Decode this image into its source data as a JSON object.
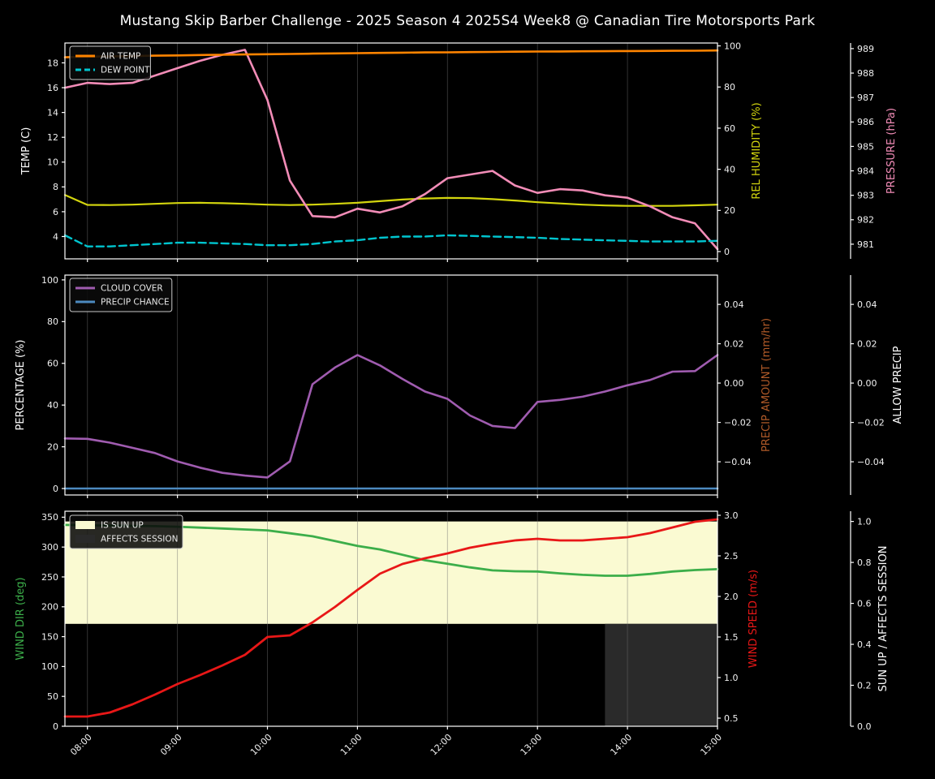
{
  "title": "Mustang Skip Barber Challenge - 2025 Season 4 2025S4 Week8 @ Canadian Tire Motorsports Park",
  "x_axis": {
    "start": "07:45",
    "end": "15:00",
    "tick_labels": [
      "08:00",
      "09:00",
      "10:00",
      "11:00",
      "12:00",
      "13:00",
      "14:00",
      "15:00"
    ]
  },
  "times": [
    "07:45",
    "08:00",
    "08:15",
    "08:30",
    "08:45",
    "09:00",
    "09:15",
    "09:30",
    "09:45",
    "10:00",
    "10:15",
    "10:30",
    "10:45",
    "11:00",
    "11:15",
    "11:30",
    "11:45",
    "12:00",
    "12:15",
    "12:30",
    "12:45",
    "13:00",
    "13:15",
    "13:30",
    "13:45",
    "14:00",
    "14:15",
    "14:30",
    "14:45",
    "15:00"
  ],
  "colors": {
    "background": "#000000",
    "spine": "#ffffff",
    "tick_text": "#f0f0f0",
    "grid": "#6e6e6e",
    "air_temp": "#ff8400",
    "dew_point": "#00c5cf",
    "rel_humidity": "#d3d50e",
    "pressure": "#f28cb7",
    "cloud_cover": "#a05cb0",
    "precip_chance": "#4d8ac0",
    "precip_amount_label": "#b05a28",
    "wind_dir": "#3cae4a",
    "wind_speed": "#e81717",
    "sun_up_band": "#fafad2",
    "affects_session_band": "#2a2a2a"
  },
  "chart_data": [
    {
      "type": "line",
      "name": "temperature-humidity-pressure",
      "left_axis": {
        "label": "TEMP (C)",
        "color": "#ffffff",
        "tick_labels": [
          "4",
          "6",
          "8",
          "10",
          "12",
          "14",
          "16",
          "18"
        ],
        "tick_values": [
          4,
          6,
          8,
          10,
          12,
          14,
          16,
          18
        ],
        "range": [
          2.2,
          19.6
        ]
      },
      "right_axis": {
        "label": "REL HUMIDITY (%)",
        "color": "#d3d50e",
        "tick_labels": [
          "0",
          "20",
          "40",
          "60",
          "80",
          "100"
        ],
        "tick_values": [
          0,
          20,
          40,
          60,
          80,
          100
        ],
        "range": [
          -3.55,
          101.4
        ]
      },
      "far_right_axis": {
        "label": "PRESSURE (hPa)",
        "color": "#f28cb7",
        "tick_labels": [
          "981",
          "982",
          "983",
          "984",
          "985",
          "986",
          "987",
          "988",
          "989"
        ],
        "tick_values": [
          981,
          982,
          983,
          984,
          985,
          986,
          987,
          988,
          989
        ],
        "range": [
          980.4,
          989.23
        ]
      },
      "legend": [
        {
          "label": "AIR TEMP",
          "color": "#ff8400",
          "swatch": "line"
        },
        {
          "label": "DEW POINT",
          "color": "#00c5cf",
          "swatch": "dashed-line"
        }
      ],
      "series": [
        {
          "name": "REL HUMIDITY",
          "axis": "right",
          "color": "#d3d50e",
          "width": 2.2,
          "values": [
            27.5,
            22.7,
            22.6,
            22.8,
            23.2,
            23.6,
            23.7,
            23.5,
            23.2,
            22.8,
            22.6,
            22.8,
            23.2,
            23.7,
            24.5,
            25.3,
            25.8,
            26.1,
            26.0,
            25.5,
            24.8,
            24.0,
            23.4,
            22.8,
            22.4,
            22.2,
            22.2,
            22.2,
            22.5,
            22.8
          ]
        },
        {
          "name": "PRESSURE",
          "axis": "far",
          "color": "#f28cb7",
          "width": 2.6,
          "values": [
            987.4,
            987.6,
            987.55,
            987.6,
            987.9,
            988.2,
            988.5,
            988.75,
            988.95,
            986.9,
            983.6,
            982.15,
            982.1,
            982.45,
            982.3,
            982.55,
            983.05,
            983.7,
            983.85,
            984.0,
            983.4,
            983.1,
            983.25,
            983.2,
            983.0,
            982.9,
            982.55,
            982.1,
            981.85,
            980.8
          ]
        },
        {
          "name": "DEW POINT",
          "axis": "left",
          "color": "#00c5cf",
          "width": 2.4,
          "dash": "9 5",
          "values": [
            4.1,
            3.2,
            3.2,
            3.3,
            3.4,
            3.5,
            3.5,
            3.45,
            3.4,
            3.3,
            3.3,
            3.4,
            3.6,
            3.7,
            3.9,
            4.0,
            4.0,
            4.1,
            4.05,
            4.0,
            3.95,
            3.9,
            3.8,
            3.75,
            3.7,
            3.65,
            3.6,
            3.6,
            3.6,
            3.65
          ]
        },
        {
          "name": "AIR TEMP",
          "axis": "left",
          "color": "#ff8400",
          "width": 2.6,
          "values": [
            18.45,
            18.5,
            18.52,
            18.55,
            18.58,
            18.6,
            18.63,
            18.65,
            18.68,
            18.7,
            18.72,
            18.74,
            18.76,
            18.78,
            18.8,
            18.82,
            18.84,
            18.85,
            18.87,
            18.88,
            18.9,
            18.91,
            18.92,
            18.93,
            18.94,
            18.95,
            18.96,
            18.97,
            18.98,
            19.0
          ]
        }
      ]
    },
    {
      "type": "line",
      "name": "cloud-precипitation",
      "left_axis": {
        "label": "PERCENTAGE (%)",
        "color": "#ffffff",
        "tick_labels": [
          "0",
          "20",
          "40",
          "60",
          "80",
          "100"
        ],
        "tick_values": [
          0,
          20,
          40,
          60,
          80,
          100
        ],
        "range": [
          -3.1,
          102.3
        ]
      },
      "right_axis": {
        "label": "PRECIP AMOUNT (mm/hr)",
        "color": "#b05a28",
        "tick_labels": [
          "0.04",
          "0.02",
          "0.00",
          "−0.02",
          "−0.04"
        ],
        "tick_values": [
          0.04,
          0.02,
          0.0,
          -0.02,
          -0.04
        ],
        "range": [
          -0.0569,
          0.0549
        ]
      },
      "far_right_axis": {
        "label": "ALLOW PRECIP",
        "color": "#ffffff",
        "tick_labels": [
          "0.04",
          "0.02",
          "0.00",
          "−0.02",
          "−0.04"
        ],
        "tick_values": [
          0.04,
          0.02,
          0.0,
          -0.02,
          -0.04
        ],
        "range": [
          -0.0569,
          0.0549
        ]
      },
      "legend": [
        {
          "label": "CLOUD COVER",
          "color": "#a05cb0",
          "swatch": "line"
        },
        {
          "label": "PRECIP CHANCE",
          "color": "#4d8ac0",
          "swatch": "line"
        }
      ],
      "series": [
        {
          "name": "CLOUD COVER",
          "axis": "left",
          "color": "#a05cb0",
          "width": 2.6,
          "values": [
            24,
            23.8,
            22,
            19.5,
            17,
            13,
            10,
            7.5,
            6.2,
            5.3,
            13,
            50,
            58,
            64,
            59,
            52.5,
            46.5,
            43,
            35,
            30,
            29,
            41.5,
            42.5,
            44,
            46.5,
            49.5,
            52,
            56,
            56.3,
            64
          ]
        },
        {
          "name": "PRECIP CHANCE",
          "axis": "left",
          "color": "#4d8ac0",
          "width": 2.6,
          "values": [
            0,
            0,
            0,
            0,
            0,
            0,
            0,
            0,
            0,
            0,
            0,
            0,
            0,
            0,
            0,
            0,
            0,
            0,
            0,
            0,
            0,
            0,
            0,
            0,
            0,
            0,
            0,
            0,
            0,
            0
          ]
        }
      ]
    },
    {
      "type": "line",
      "name": "wind-sun",
      "left_axis": {
        "label": "WIND DIR (deg)",
        "color": "#3cae4a",
        "tick_labels": [
          "0",
          "50",
          "100",
          "150",
          "200",
          "250",
          "300",
          "350"
        ],
        "tick_values": [
          0,
          50,
          100,
          150,
          200,
          250,
          300,
          350
        ],
        "range": [
          0,
          360
        ]
      },
      "right_axis": {
        "label": "WIND SPEED (m/s)",
        "color": "#e81717",
        "tick_labels": [
          "0.5",
          "1.0",
          "1.5",
          "2.0",
          "2.5",
          "3.0"
        ],
        "tick_values": [
          0.5,
          1.0,
          1.5,
          2.0,
          2.5,
          3.0
        ],
        "range": [
          0.4,
          3.05
        ]
      },
      "far_right_axis": {
        "label": "SUN UP / AFFECTS SESSION",
        "color": "#ffffff",
        "tick_labels": [
          "0.0",
          "0.2",
          "0.4",
          "0.6",
          "0.8",
          "1.0"
        ],
        "tick_values": [
          0.0,
          0.2,
          0.4,
          0.6,
          0.8,
          1.0
        ],
        "range": [
          0,
          1.05
        ]
      },
      "legend": [
        {
          "label": "IS SUN UP",
          "color": "#fafad2",
          "swatch": "patch"
        },
        {
          "label": "AFFECTS SESSION",
          "color": "#2a2a2a",
          "swatch": "patch"
        }
      ],
      "bands": [
        {
          "name": "IS SUN UP",
          "axis": "far",
          "color": "#fafad2",
          "from": 0.5,
          "to": 1.0,
          "values": [
            1,
            1,
            1,
            1,
            1,
            1,
            1,
            1,
            1,
            1,
            1,
            1,
            1,
            1,
            1,
            1,
            1,
            1,
            1,
            1,
            1,
            1,
            1,
            1,
            1,
            1,
            1,
            1,
            1,
            1
          ]
        },
        {
          "name": "AFFECTS SESSION",
          "axis": "far",
          "color": "#2a2a2a",
          "from": 0.0,
          "to": 0.5,
          "values": [
            0,
            0,
            0,
            0,
            0,
            0,
            0,
            0,
            0,
            0,
            0,
            0,
            0,
            0,
            0,
            0,
            0,
            0,
            0,
            0,
            0,
            0,
            0,
            0,
            1,
            1,
            1,
            1,
            1,
            1
          ]
        }
      ],
      "series": [
        {
          "name": "WIND DIR",
          "axis": "left",
          "color": "#3cae4a",
          "width": 2.8,
          "values": [
            337,
            336.5,
            336,
            335.5,
            335,
            334,
            332.5,
            331,
            329.5,
            328,
            323,
            318,
            310,
            302,
            296,
            287,
            278,
            272,
            266,
            261,
            259.5,
            259,
            256,
            253.5,
            252,
            252,
            255,
            259,
            261.5,
            263
          ]
        },
        {
          "name": "WIND SPEED",
          "axis": "right",
          "color": "#e81717",
          "width": 2.8,
          "values": [
            0.52,
            0.52,
            0.57,
            0.67,
            0.79,
            0.92,
            1.03,
            1.15,
            1.28,
            1.5,
            1.52,
            1.68,
            1.87,
            2.08,
            2.28,
            2.4,
            2.47,
            2.53,
            2.6,
            2.65,
            2.69,
            2.71,
            2.69,
            2.69,
            2.71,
            2.73,
            2.78,
            2.85,
            2.92,
            2.95
          ]
        }
      ]
    }
  ]
}
